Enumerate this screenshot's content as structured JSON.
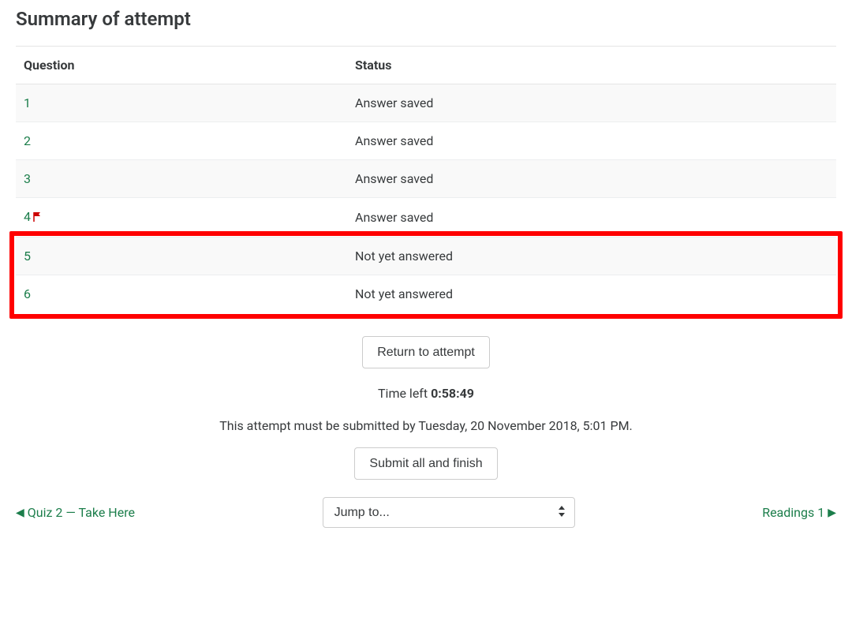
{
  "page": {
    "title": "Summary of attempt"
  },
  "table": {
    "headers": {
      "question": "Question",
      "status": "Status"
    },
    "rows": [
      {
        "num": "1",
        "flagged": false,
        "status": "Answer saved",
        "unanswered": false
      },
      {
        "num": "2",
        "flagged": false,
        "status": "Answer saved",
        "unanswered": false
      },
      {
        "num": "3",
        "flagged": false,
        "status": "Answer saved",
        "unanswered": false
      },
      {
        "num": "4",
        "flagged": true,
        "status": "Answer saved",
        "unanswered": false
      },
      {
        "num": "5",
        "flagged": false,
        "status": "Not yet answered",
        "unanswered": true
      },
      {
        "num": "6",
        "flagged": false,
        "status": "Not yet answered",
        "unanswered": true
      }
    ]
  },
  "buttons": {
    "return": "Return to attempt",
    "submit": "Submit all and finish"
  },
  "timer": {
    "label": "Time left ",
    "value": "0:58:49"
  },
  "deadline": "This attempt must be submitted by Tuesday, 20 November 2018, 5:01 PM.",
  "nav": {
    "prev": "Quiz 2 — Take Here",
    "next": "Readings 1",
    "jump_placeholder": "Jump to..."
  }
}
